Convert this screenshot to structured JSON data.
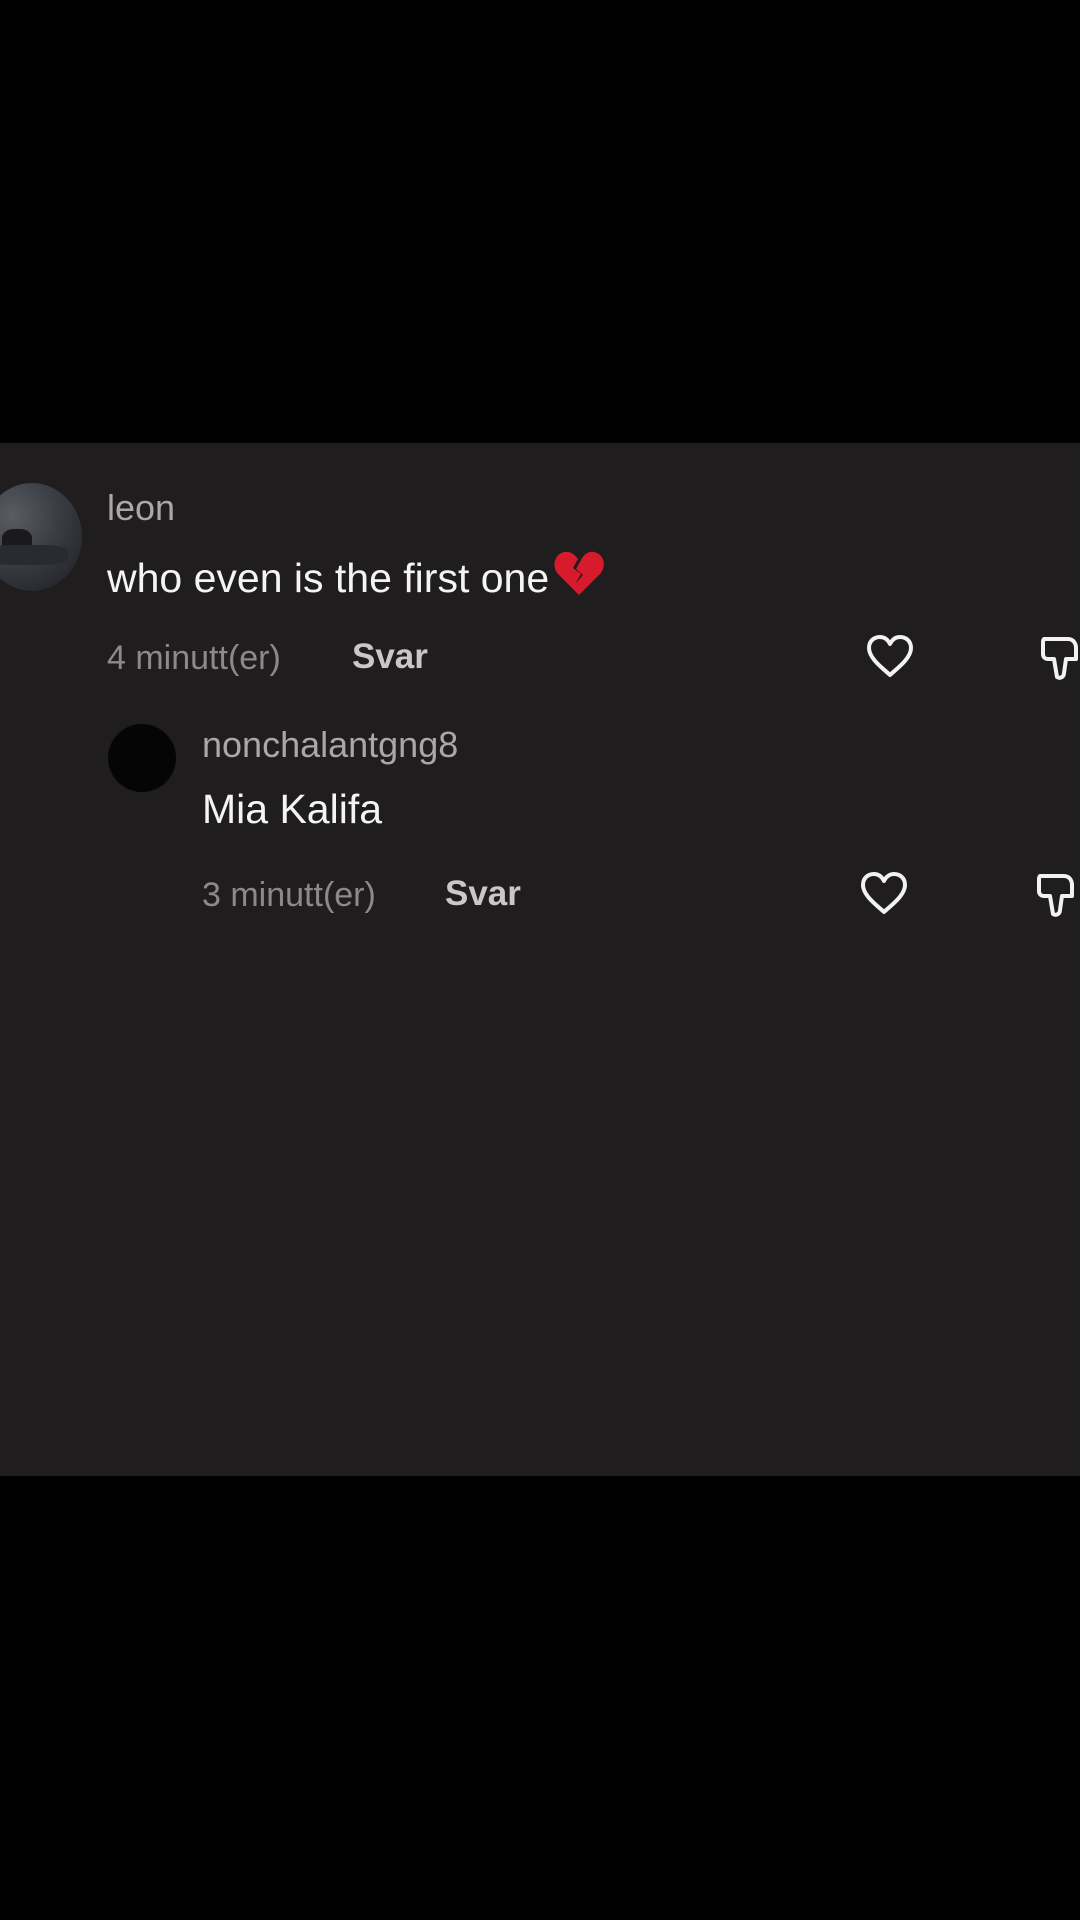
{
  "comments": [
    {
      "username": "leon",
      "text": "who even is the first one",
      "emoji": "broken-heart",
      "time": "4 minutt(er)",
      "reply_label": "Svar"
    },
    {
      "username": "nonchalantgng8",
      "text": "Mia Kalifa",
      "time": "3 minutt(er)",
      "reply_label": "Svar"
    }
  ],
  "colors": {
    "panel_background": "#1f1d1e",
    "page_background": "#000000",
    "comment_text": "#f4f4f4",
    "username_text": "#a9a7a8",
    "time_text": "#8b898a",
    "broken_heart": "#d81b2c"
  }
}
